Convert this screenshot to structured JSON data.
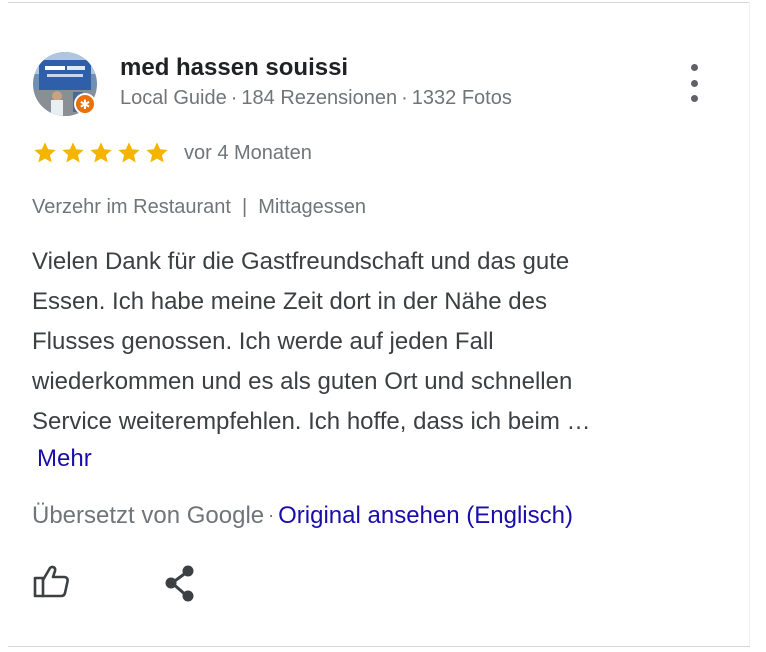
{
  "reviewer": {
    "name": "med hassen souissi",
    "badge": "Local Guide",
    "reviews_count": "184 Rezensionen",
    "photos_count": "1332 Fotos",
    "separator": "·"
  },
  "rating": {
    "value": 5,
    "max": 5,
    "star_color": "#f4b400"
  },
  "time_ago": "vor 4 Monaten",
  "tags": {
    "dining": "Verzehr im Restaurant",
    "meal": "Mittagessen",
    "separator": "|"
  },
  "review_lines": [
    "Vielen Dank für die Gastfreundschaft und das gute",
    "Essen. Ich habe meine Zeit dort in der Nähe des",
    "Flusses genossen. Ich werde auf jeden Fall",
    "wiederkommen und es als guten Ort und schnellen",
    "Service weiterempfehlen. Ich hoffe, dass ich beim …"
  ],
  "more_link": "Mehr",
  "translation": {
    "label": "Übersetzt von Google",
    "separator": "·",
    "original_link": "Original ansehen (Englisch)"
  },
  "icons": {
    "menu": "more-vert-icon",
    "like": "thumbs-up-icon",
    "share": "share-icon",
    "badge": "local-guide-star-icon"
  },
  "colors": {
    "link": "#1a0dab",
    "secondary_text": "#70757a",
    "badge": "#e8710a"
  }
}
